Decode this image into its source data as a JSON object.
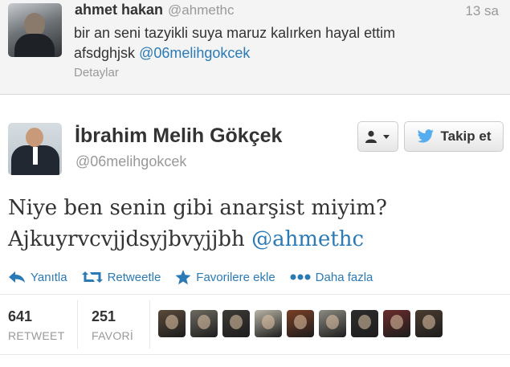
{
  "reply": {
    "name": "ahmet hakan",
    "handle": "@ahmethc",
    "time": "13 sa",
    "text_line1": "bir an seni tazyikli suya maruz kalırken hayal ettim",
    "text_line2_prefix": "afsdghjsk",
    "text_mention": "@06melihgokcek",
    "details_label": "Detaylar"
  },
  "tweet": {
    "name": "İbrahim Melih Gökçek",
    "handle": "@06melihgokcek",
    "follow_label": "Takip et",
    "text_line1": "Niye ben senin gibi anarşist miyim?",
    "text_line2_prefix": "Ajkuyrvcvjjdsyjbvyjjbh",
    "text_mention": "@ahmethc"
  },
  "actions": {
    "reply_label": "Yanıtla",
    "retweet_label": "Retweetle",
    "favorite_label": "Favorilere ekle",
    "more_label": "Daha fazla"
  },
  "stats": {
    "retweets": "641",
    "retweets_label": "RETWEET",
    "favorites": "251",
    "favorites_label": "FAVORİ"
  },
  "colors": {
    "link": "#2a7ab5",
    "text": "#333333",
    "muted": "#999999"
  },
  "favoriters": [
    {
      "name": "favoriter-1",
      "color": "#5a4a3a"
    },
    {
      "name": "favoriter-2",
      "color": "#6d6a60"
    },
    {
      "name": "favoriter-3",
      "color": "#3d3a36"
    },
    {
      "name": "favoriter-4",
      "color": "#b9b4a6"
    },
    {
      "name": "favoriter-5",
      "color": "#7a3f25"
    },
    {
      "name": "favoriter-6",
      "color": "#8c8a80"
    },
    {
      "name": "favoriter-7",
      "color": "#2c2c2c"
    },
    {
      "name": "favoriter-8",
      "color": "#6b2b2b"
    },
    {
      "name": "favoriter-9",
      "color": "#4a3c30"
    }
  ]
}
